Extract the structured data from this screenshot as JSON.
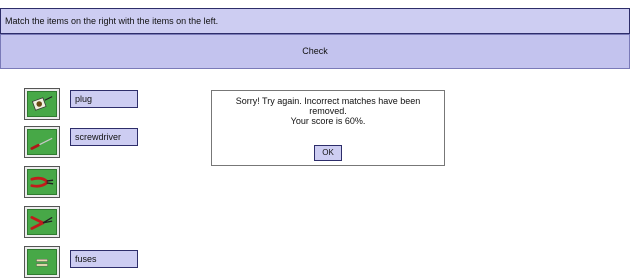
{
  "instruction": {
    "text": "Match the items on the right with the items on the left."
  },
  "check_button": {
    "label": "Check"
  },
  "tiles": [
    {
      "icon": "plug-icon"
    },
    {
      "icon": "screwdriver-icon"
    },
    {
      "icon": "pliers-icon"
    },
    {
      "icon": "wire-cutters-icon"
    },
    {
      "icon": "fuse-icon"
    }
  ],
  "matched_labels": {
    "plug": "plug",
    "screwdriver": "screwdriver",
    "fuses": "fuses"
  },
  "dialog": {
    "line1": "Sorry! Try again. Incorrect matches have been",
    "line2": "removed.",
    "line3": "Your score is 60%.",
    "ok_label": "OK"
  },
  "colors": {
    "bar_fill": "#cdcdf2",
    "border": "#2d2d6a",
    "tile_green": "#47a847"
  }
}
